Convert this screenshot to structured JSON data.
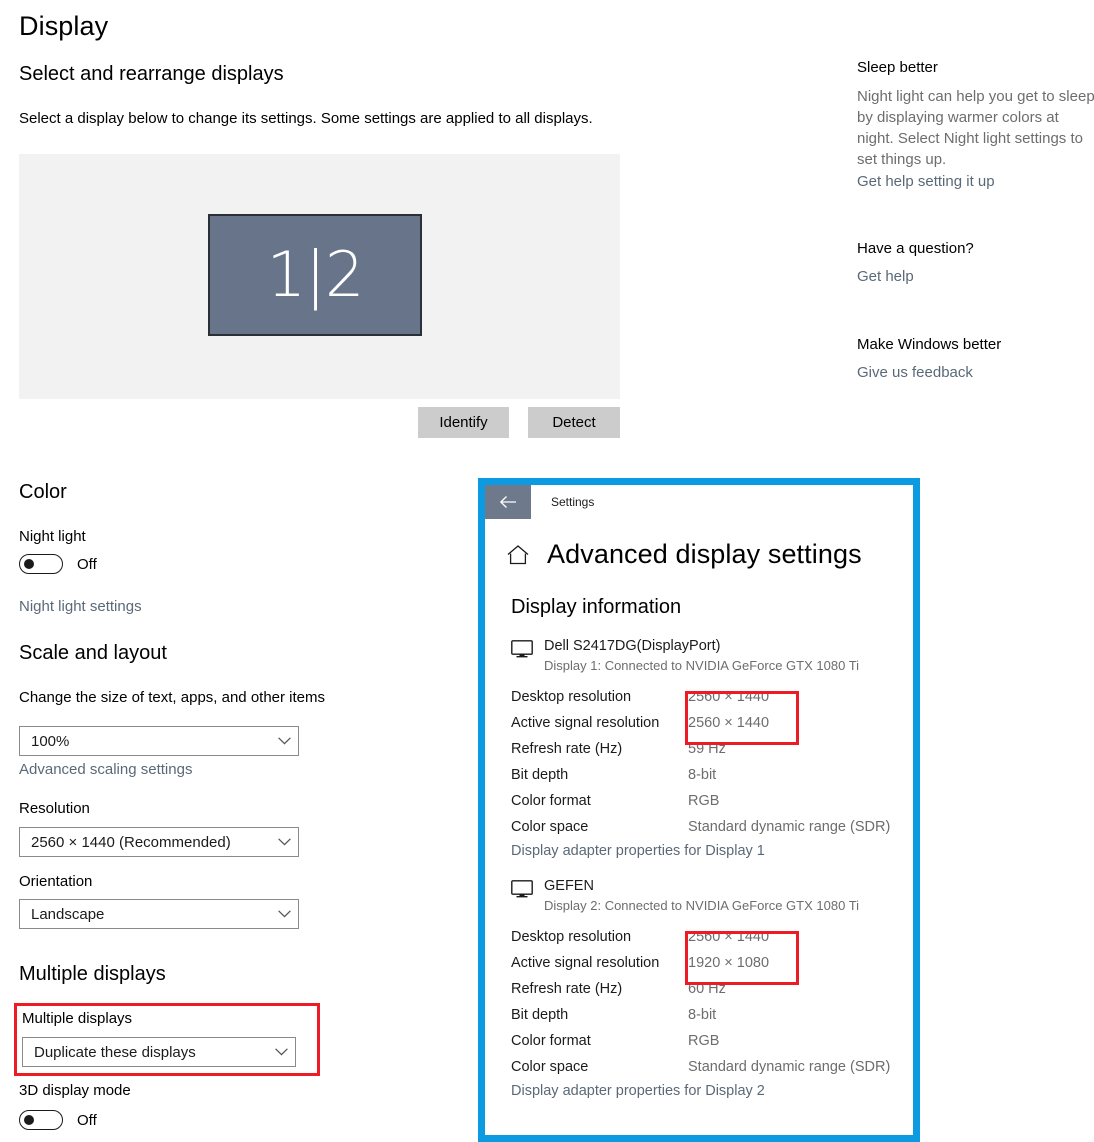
{
  "page": {
    "title": "Display",
    "select_rearrange": {
      "heading": "Select and rearrange displays",
      "description": "Select a display below to change its settings. Some settings are applied to all displays.",
      "display_tile_label": "1|2",
      "identify_button": "Identify",
      "detect_button": "Detect"
    },
    "color": {
      "heading": "Color",
      "night_light_label": "Night light",
      "night_light_state": "Off",
      "night_light_settings_link": "Night light settings"
    },
    "scale_and_layout": {
      "heading": "Scale and layout",
      "scale_label": "Change the size of text, apps, and other items",
      "scale_value": "100%",
      "advanced_scaling_link": "Advanced scaling settings",
      "resolution_label": "Resolution",
      "resolution_value": "2560 × 1440 (Recommended)",
      "orientation_label": "Orientation",
      "orientation_value": "Landscape"
    },
    "multiple_displays": {
      "heading": "Multiple displays",
      "field_label": "Multiple displays",
      "field_value": "Duplicate these displays",
      "threed_label": "3D display mode",
      "threed_state": "Off"
    }
  },
  "right_rail": {
    "sleep_heading": "Sleep better",
    "sleep_paragraph": "Night light can help you get to sleep by displaying warmer colors at night. Select Night light settings to set things up.",
    "sleep_link": "Get help setting it up",
    "question_heading": "Have a question?",
    "question_link": "Get help",
    "feedback_heading": "Make Windows better",
    "feedback_link": "Give us feedback"
  },
  "advanced_window": {
    "titlebar_label": "Settings",
    "title": "Advanced display settings",
    "section_title": "Display information",
    "adapter_link_1": "Display adapter properties for Display 1",
    "adapter_link_2": "Display adapter properties for Display 2",
    "displays": [
      {
        "name": "Dell S2417DG(DisplayPort)",
        "connection": "Display 1: Connected to NVIDIA GeForce GTX 1080 Ti",
        "specs": [
          {
            "label": "Desktop resolution",
            "value": "2560 × 1440"
          },
          {
            "label": "Active signal resolution",
            "value": "2560 × 1440"
          },
          {
            "label": "Refresh rate (Hz)",
            "value": "59 Hz"
          },
          {
            "label": "Bit depth",
            "value": "8-bit"
          },
          {
            "label": "Color format",
            "value": "RGB"
          },
          {
            "label": "Color space",
            "value": "Standard dynamic range (SDR)"
          }
        ]
      },
      {
        "name": "GEFEN",
        "connection": "Display 2: Connected to NVIDIA GeForce GTX 1080 Ti",
        "specs": [
          {
            "label": "Desktop resolution",
            "value": "2560 × 1440"
          },
          {
            "label": "Active signal resolution",
            "value": "1920 × 1080"
          },
          {
            "label": "Refresh rate (Hz)",
            "value": "60 Hz"
          },
          {
            "label": "Bit depth",
            "value": "8-bit"
          },
          {
            "label": "Color format",
            "value": "RGB"
          },
          {
            "label": "Color space",
            "value": "Standard dynamic range (SDR)"
          }
        ]
      }
    ]
  },
  "colors": {
    "annotation_red": "#ed1c24",
    "annotation_blue": "#0c9ae0",
    "monitor_tile": "#68748a",
    "link_blue_gray": "#5a6978",
    "button_gray": "#cccccc",
    "canvas_gray": "#f2f2f2"
  }
}
